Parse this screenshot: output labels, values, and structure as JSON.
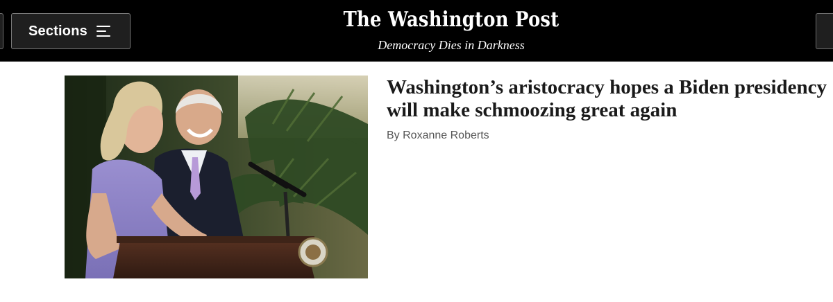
{
  "header": {
    "sections_label": "Sections",
    "logo_text": "The Washington Post",
    "tagline": "Democracy Dies in Darkness",
    "background": "#000000"
  },
  "article": {
    "headline": "Washington’s aristocracy hopes a Biden presidency will make schmoozing great again",
    "byline": "By Roxanne Roberts",
    "image_subject": "photo of a woman in a lavender dress and a man in a dark suit laughing at a podium with microphones, palm foliage behind"
  },
  "icons": {
    "menu": "menu-icon"
  }
}
